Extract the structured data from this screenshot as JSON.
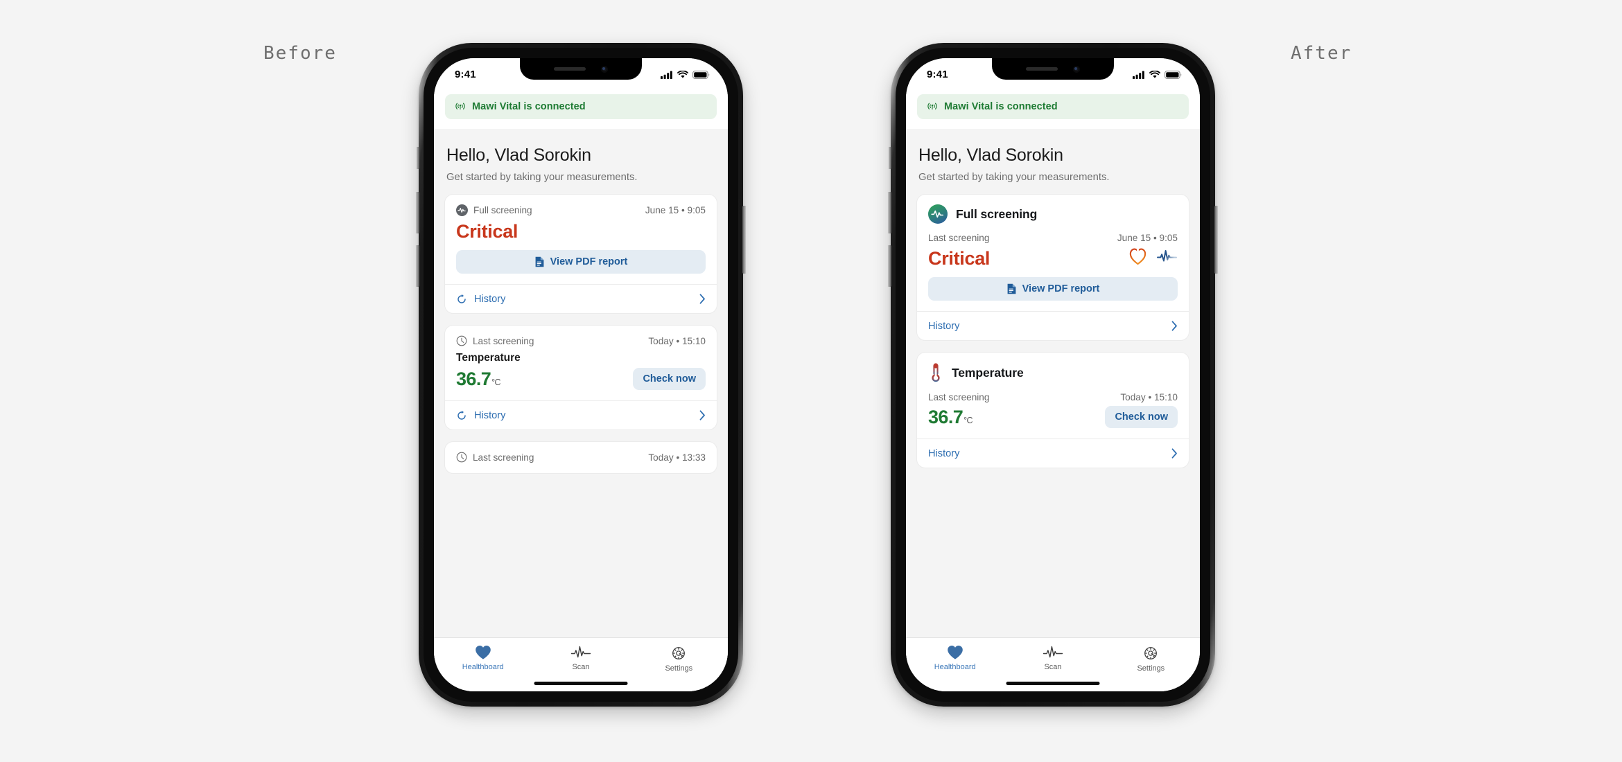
{
  "page": {
    "background_color": "#f4f4f4",
    "caption_before": "Before",
    "caption_after": "After"
  },
  "status_bar": {
    "time": "9:41",
    "icons": [
      "cellular-signal-icon",
      "wifi-icon",
      "battery-icon"
    ]
  },
  "banner": {
    "icon": "broadcast-icon",
    "text": "Mawi Vital is connected",
    "text_color": "#1e7b33",
    "background_color": "#e8f3e9"
  },
  "header": {
    "greeting": "Hello, Vlad Sorokin",
    "subtitle": "Get started by taking your measurements."
  },
  "before": {
    "full_screening_card": {
      "icon": "pulse-circle-icon",
      "meta_label": "Full screening",
      "meta_value": "June 15 • 9:05",
      "status": "Critical",
      "status_color": "#c8371c",
      "pdf_button": "View PDF report",
      "pdf_icon": "document-icon",
      "history_label": "History",
      "history_icon": "refresh-icon",
      "chevron_icon": "chevron-right-icon"
    },
    "temperature_card": {
      "icon": "clock-icon",
      "meta_label": "Last screening",
      "meta_value": "Today • 15:10",
      "title": "Temperature",
      "value": "36.7",
      "unit": "°C",
      "value_color": "#1f7a33",
      "action_button": "Check now",
      "history_label": "History",
      "history_icon": "refresh-icon",
      "chevron_icon": "chevron-right-icon"
    },
    "third_card": {
      "icon": "clock-icon",
      "meta_label": "Last screening",
      "meta_value": "Today • 13:33"
    }
  },
  "after": {
    "full_screening_card": {
      "icon": "pulse-circle-gradient-icon",
      "title": "Full screening",
      "meta_label": "Last screening",
      "meta_value": "June 15 • 9:05",
      "status": "Critical",
      "status_color": "#c8371c",
      "indicator_icons": [
        "heart-outline-icon",
        "ecg-wave-icon"
      ],
      "pdf_button": "View PDF report",
      "pdf_icon": "document-icon",
      "history_label": "History",
      "chevron_icon": "chevron-right-icon"
    },
    "temperature_card": {
      "icon": "thermometer-icon",
      "title": "Temperature",
      "meta_label": "Last screening",
      "meta_value": "Today • 15:10",
      "value": "36.7",
      "unit": "°C",
      "value_color": "#1f7a33",
      "action_button": "Check now",
      "history_label": "History",
      "chevron_icon": "chevron-right-icon"
    }
  },
  "tabbar": {
    "tabs": [
      {
        "label": "Healthboard",
        "icon": "heart-icon",
        "active": true
      },
      {
        "label": "Scan",
        "icon": "ecg-scan-icon",
        "active": false
      },
      {
        "label": "Settings",
        "icon": "gear-icon",
        "active": false
      }
    ],
    "active_color": "#3b77b8"
  }
}
